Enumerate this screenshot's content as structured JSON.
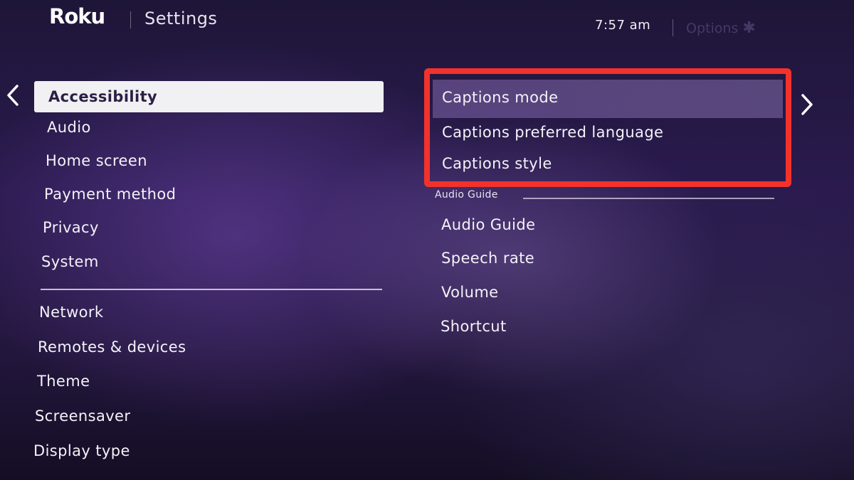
{
  "header": {
    "logo": "Roku",
    "title": "Settings",
    "time": "7:57  am",
    "options_label": "Options",
    "options_icon": "asterisk-icon"
  },
  "nav": {
    "back_icon": "chevron-left-icon",
    "forward_icon": "chevron-right-icon"
  },
  "menu": {
    "selected_index": 0,
    "items_top": [
      "Accessibility",
      "Audio",
      "Home screen",
      "Payment method",
      "Privacy",
      "System"
    ],
    "items_bottom": [
      "Network",
      "Remotes & devices",
      "Theme",
      "Screensaver",
      "Display type"
    ]
  },
  "panel": {
    "captions": [
      "Captions mode",
      "Captions preferred language",
      "Captions style"
    ],
    "audio_guide_section": "Audio Guide",
    "audio_guide_items": [
      "Audio Guide",
      "Speech rate",
      "Volume",
      "Shortcut"
    ]
  },
  "colors": {
    "highlight_box": "#f2322b",
    "selected_bg": "#f1f0f2",
    "selected_text": "#2a1f45"
  }
}
